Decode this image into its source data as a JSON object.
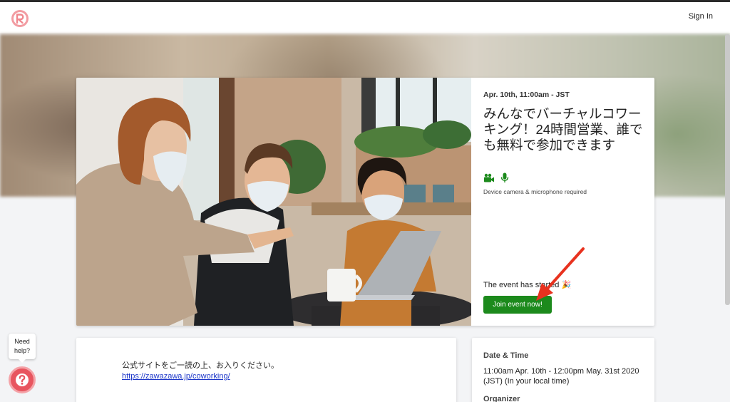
{
  "navbar": {
    "signin_label": "Sign In"
  },
  "event": {
    "date": "Apr. 10th, 11:00am - JST",
    "title": "みんなでバーチャルコワーキング！24時間営業、誰でも無料で参加できます",
    "device_note": "Device camera & microphone required",
    "started_text": "The event has started 🎉",
    "join_label": "Join event now!"
  },
  "description": {
    "text": "公式サイトをご一読の上、お入りください。",
    "link": "https://zawazawa.jp/coworking/"
  },
  "details": {
    "date_time_label": "Date & Time",
    "date_time_value": "11:00am Apr. 10th - 12:00pm May. 31st 2020 (JST) (In your local time)",
    "organizer_label": "Organizer"
  },
  "help": {
    "bubble_text": "Need help?"
  },
  "colors": {
    "brand": "#e8555f",
    "join_button": "#1c8a1c",
    "link": "#1a34c8",
    "arrow": "#e8321f"
  },
  "icons": [
    "logo-icon",
    "video-camera-icon",
    "microphone-icon",
    "help-question-icon"
  ]
}
